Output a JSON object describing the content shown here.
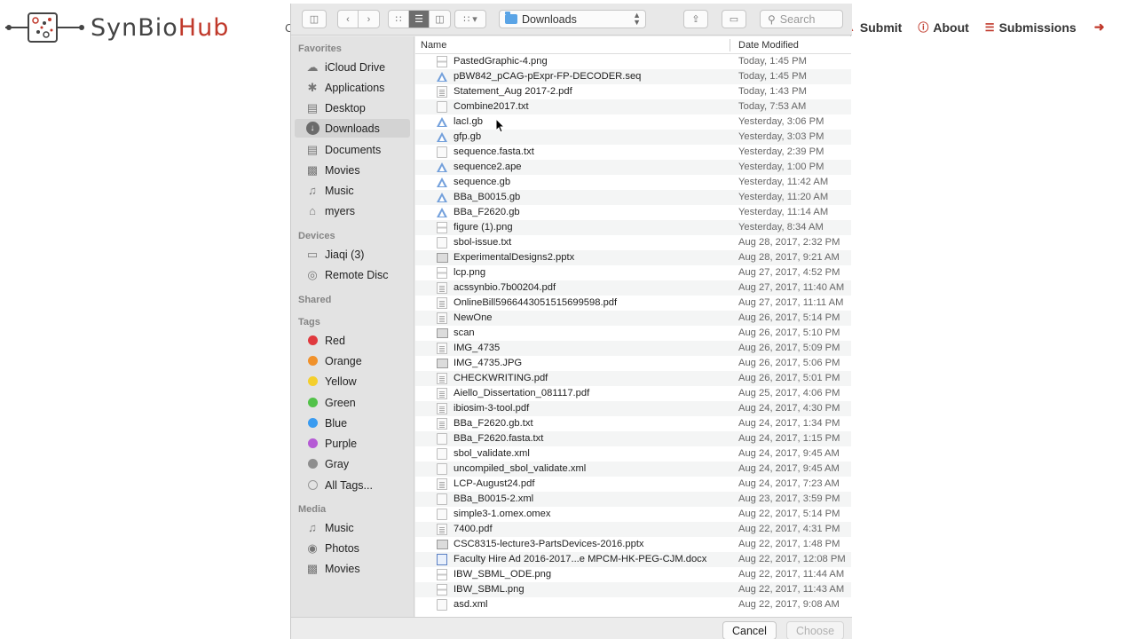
{
  "site": {
    "logo_text_prefix": "SynBio",
    "logo_text_suffix": "Hub",
    "header_fragment": "C",
    "nav": [
      {
        "label": "Submit",
        "icon": "upload-icon"
      },
      {
        "label": "About",
        "icon": "info-icon"
      },
      {
        "label": "Submissions",
        "icon": "list-icon"
      }
    ],
    "logout_icon": "sign-out-icon",
    "accent_color": "#c0392b"
  },
  "dialog": {
    "location": "Downloads",
    "search_placeholder": "Search",
    "columns": {
      "name": "Name",
      "date": "Date Modified"
    },
    "cancel_label": "Cancel",
    "choose_label": "Choose"
  },
  "sidebar": {
    "favorites_heading": "Favorites",
    "favorites": [
      {
        "label": "iCloud Drive",
        "icon": "cloud-icon"
      },
      {
        "label": "Applications",
        "icon": "applications-icon"
      },
      {
        "label": "Desktop",
        "icon": "desktop-icon"
      },
      {
        "label": "Downloads",
        "icon": "downloads-icon",
        "selected": true
      },
      {
        "label": "Documents",
        "icon": "documents-icon"
      },
      {
        "label": "Movies",
        "icon": "movies-icon"
      },
      {
        "label": "Music",
        "icon": "music-icon"
      },
      {
        "label": "myers",
        "icon": "home-icon"
      }
    ],
    "devices_heading": "Devices",
    "devices": [
      {
        "label": "Jiaqi (3)",
        "icon": "laptop-icon"
      },
      {
        "label": "Remote Disc",
        "icon": "disc-icon"
      }
    ],
    "shared_heading": "Shared",
    "tags_heading": "Tags",
    "tags": [
      {
        "label": "Red",
        "color": "#e0393e"
      },
      {
        "label": "Orange",
        "color": "#f0912a"
      },
      {
        "label": "Yellow",
        "color": "#f4cf2d"
      },
      {
        "label": "Green",
        "color": "#52c249"
      },
      {
        "label": "Blue",
        "color": "#3a9bf0"
      },
      {
        "label": "Purple",
        "color": "#b55ad5"
      },
      {
        "label": "Gray",
        "color": "#8e8e8e"
      },
      {
        "label": "All Tags...",
        "color": "hollow"
      }
    ],
    "media_heading": "Media",
    "media": [
      {
        "label": "Music",
        "icon": "music-icon"
      },
      {
        "label": "Photos",
        "icon": "camera-icon"
      },
      {
        "label": "Movies",
        "icon": "movies-icon"
      }
    ]
  },
  "files": [
    {
      "name": "PastedGraphic-4.png",
      "date": "Today, 1:45 PM",
      "type": "img"
    },
    {
      "name": "pBW842_pCAG-pExpr-FP-DECODER.seq",
      "date": "Today, 1:45 PM",
      "type": "sbol"
    },
    {
      "name": "Statement_Aug 2017-2.pdf",
      "date": "Today, 1:43 PM",
      "type": "pdf"
    },
    {
      "name": "Combine2017.txt",
      "date": "Today, 7:53 AM",
      "type": "doc"
    },
    {
      "name": "lacI.gb",
      "date": "Yesterday, 3:06 PM",
      "type": "sbol"
    },
    {
      "name": "gfp.gb",
      "date": "Yesterday, 3:03 PM",
      "type": "sbol"
    },
    {
      "name": "sequence.fasta.txt",
      "date": "Yesterday, 2:39 PM",
      "type": "doc"
    },
    {
      "name": "sequence2.ape",
      "date": "Yesterday, 1:00 PM",
      "type": "sbol"
    },
    {
      "name": "sequence.gb",
      "date": "Yesterday, 11:42 AM",
      "type": "sbol"
    },
    {
      "name": "BBa_B0015.gb",
      "date": "Yesterday, 11:20 AM",
      "type": "sbol"
    },
    {
      "name": "BBa_F2620.gb",
      "date": "Yesterday, 11:14 AM",
      "type": "sbol"
    },
    {
      "name": "figure (1).png",
      "date": "Yesterday, 8:34 AM",
      "type": "img"
    },
    {
      "name": "sbol-issue.txt",
      "date": "Aug 28, 2017, 2:32 PM",
      "type": "doc"
    },
    {
      "name": "ExperimentalDesigns2.pptx",
      "date": "Aug 28, 2017, 9:21 AM",
      "type": "ppt"
    },
    {
      "name": "lcp.png",
      "date": "Aug 27, 2017, 4:52 PM",
      "type": "img"
    },
    {
      "name": "acssynbio.7b00204.pdf",
      "date": "Aug 27, 2017, 11:40 AM",
      "type": "pdf"
    },
    {
      "name": "OnlineBill5966443051515699598.pdf",
      "date": "Aug 27, 2017, 11:11 AM",
      "type": "pdf"
    },
    {
      "name": "NewOne",
      "date": "Aug 26, 2017, 5:14 PM",
      "type": "pdf"
    },
    {
      "name": "scan",
      "date": "Aug 26, 2017, 5:10 PM",
      "type": "ppt"
    },
    {
      "name": "IMG_4735",
      "date": "Aug 26, 2017, 5:09 PM",
      "type": "pdf"
    },
    {
      "name": "IMG_4735.JPG",
      "date": "Aug 26, 2017, 5:06 PM",
      "type": "ppt"
    },
    {
      "name": "CHECKWRITING.pdf",
      "date": "Aug 26, 2017, 5:01 PM",
      "type": "pdf"
    },
    {
      "name": "Aiello_Dissertation_081117.pdf",
      "date": "Aug 25, 2017, 4:06 PM",
      "type": "pdf"
    },
    {
      "name": "ibiosim-3-tool.pdf",
      "date": "Aug 24, 2017, 4:30 PM",
      "type": "pdf"
    },
    {
      "name": "BBa_F2620.gb.txt",
      "date": "Aug 24, 2017, 1:34 PM",
      "type": "pdf"
    },
    {
      "name": "BBa_F2620.fasta.txt",
      "date": "Aug 24, 2017, 1:15 PM",
      "type": "doc"
    },
    {
      "name": "sbol_validate.xml",
      "date": "Aug 24, 2017, 9:45 AM",
      "type": "doc"
    },
    {
      "name": "uncompiled_sbol_validate.xml",
      "date": "Aug 24, 2017, 9:45 AM",
      "type": "doc"
    },
    {
      "name": "LCP-August24.pdf",
      "date": "Aug 24, 2017, 7:23 AM",
      "type": "pdf"
    },
    {
      "name": "BBa_B0015-2.xml",
      "date": "Aug 23, 2017, 3:59 PM",
      "type": "doc"
    },
    {
      "name": "simple3-1.omex.omex",
      "date": "Aug 22, 2017, 5:14 PM",
      "type": "doc"
    },
    {
      "name": "7400.pdf",
      "date": "Aug 22, 2017, 4:31 PM",
      "type": "pdf"
    },
    {
      "name": "CSC8315-lecture3-PartsDevices-2016.pptx",
      "date": "Aug 22, 2017, 1:48 PM",
      "type": "ppt"
    },
    {
      "name": "Faculty Hire Ad 2016-2017...e MPCM-HK-PEG-CJM.docx",
      "date": "Aug 22, 2017, 12:08 PM",
      "type": "word"
    },
    {
      "name": "IBW_SBML_ODE.png",
      "date": "Aug 22, 2017, 11:44 AM",
      "type": "img"
    },
    {
      "name": "IBW_SBML.png",
      "date": "Aug 22, 2017, 11:43 AM",
      "type": "img"
    },
    {
      "name": "asd.xml",
      "date": "Aug 22, 2017, 9:08 AM",
      "type": "doc"
    }
  ]
}
